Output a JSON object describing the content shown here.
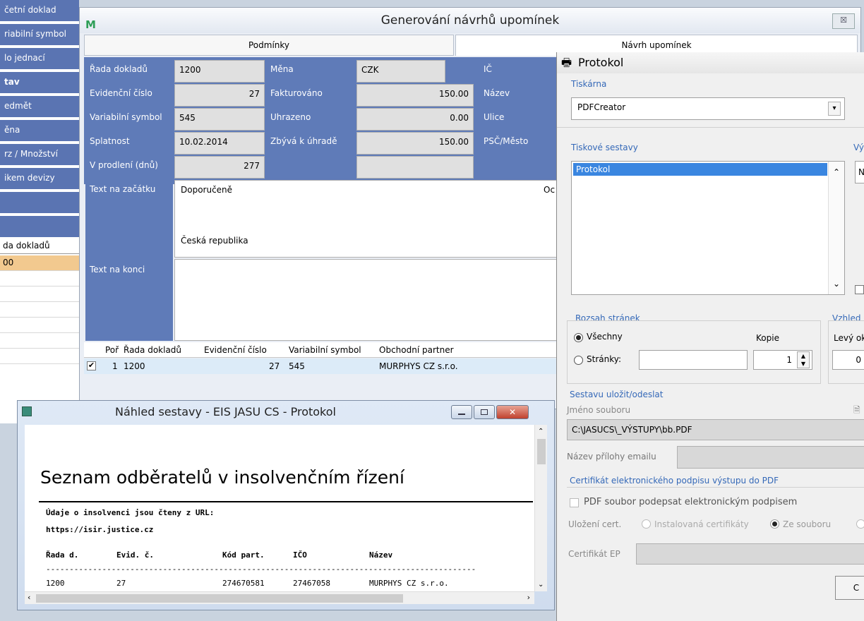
{
  "left_panel": {
    "items": [
      "četní doklad",
      "riabilní symbol",
      "lo jednací",
      "tav",
      "edmět",
      "ěna",
      "rz / Množství",
      "ikem devizy"
    ],
    "grid_label": "da dokladů",
    "grid_value": "00"
  },
  "main": {
    "title": "Generování návrhů upomínek",
    "logo": "M",
    "close": "☒",
    "tabs": [
      "Podmínky",
      "Návrh upomínek"
    ],
    "labels": {
      "rada": "Řada dokladů",
      "evid": "Evidenční číslo",
      "var": "Variabilní symbol",
      "splat": "Splatnost",
      "prodleni": "V prodlení (dnů)",
      "mena": "Měna",
      "fakt": "Fakturováno",
      "uhraz": "Uhrazeno",
      "zbyva": "Zbývá k úhradě",
      "ic": "IČ",
      "nazev": "Název",
      "ulice": "Ulice",
      "psc": "PSČ/Město",
      "text_start": "Text na začátku",
      "text_end": "Text na konci"
    },
    "values": {
      "rada": "1200",
      "evid": "27",
      "var": "545",
      "splat": "10.02.2014",
      "prodleni": "277",
      "mena": "CZK",
      "fakt": "150.00",
      "uhraz": "0.00",
      "zbyva": "150.00"
    },
    "text_start_lines": [
      "Doporučeně",
      "Česká republika"
    ],
    "text_right": "Oc",
    "table": {
      "headers": [
        "Poř",
        "Řada dokladů",
        "Evidenční číslo",
        "Variabilní symbol",
        "Obchodní partner"
      ],
      "row": {
        "checked": true,
        "por": "1",
        "rada": "1200",
        "evid": "27",
        "var": "545",
        "partner": "MURPHYS CZ s.r.o."
      }
    }
  },
  "protocol": {
    "title": "Protokol",
    "printer_label": "Tiskárna",
    "printer_value": "PDFCreator",
    "sets_label": "Tiskové sestavy",
    "sets_item": "Protokol",
    "side_label": "Vý",
    "side_field": "N",
    "range_label": "Rozsah stránek",
    "all_pages": "Všechny",
    "pages": "Stránky:",
    "copies_label": "Kopie",
    "copies_value": "1",
    "view_label": "Vzhled",
    "left_margin_label": "Levý ok",
    "left_margin_value": "0",
    "save_label": "Sestavu uložit/odeslat",
    "filename_label": "Jméno souboru",
    "filename_value": "C:\\JASUCS\\_VÝSTUPY\\bb.PDF",
    "attach_label": "Název přílohy emailu",
    "cert_label": "Certifikát elektronického podpisu výstupu do PDF",
    "sign_label": "PDF soubor podepsat elektronickým podpisem",
    "cert_store_label": "Uložení cert.",
    "installed": "Instalovaná certifikáty",
    "from_file": "Ze souboru",
    "cert_ep_label": "Certifikát EP",
    "ok_partial": "C"
  },
  "preview": {
    "title": "Náhled sestavy - EIS JASU CS - Protokol",
    "report_title": "Seznam odběratelů v insolvenčním řízení",
    "info_line1": "Údaje o insolvenci jsou čteny z URL:",
    "info_line2": "https://isir.justice.cz",
    "columns": [
      "Řada d.",
      "Evid. č.",
      "Kód part.",
      "IČO",
      "Název"
    ],
    "dashes": "--------------------------------------------------------------------------------------------",
    "row": [
      "1200",
      "27",
      "274670581",
      "27467058",
      "MURPHYS CZ s.r.o."
    ]
  }
}
